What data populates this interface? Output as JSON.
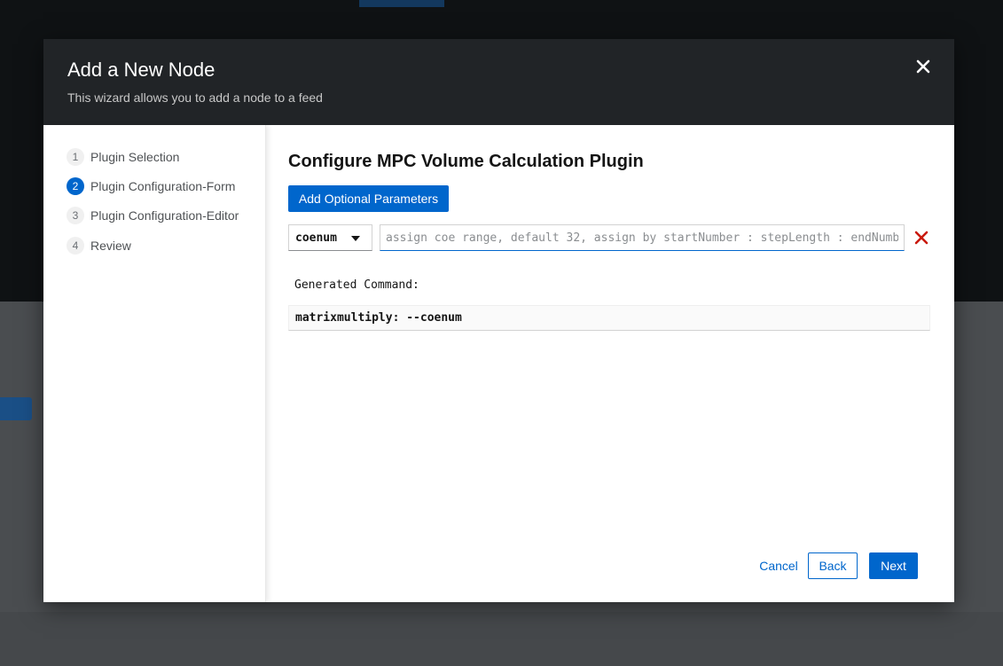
{
  "modal": {
    "title": "Add a New Node",
    "description": "This wizard allows you to add a node to a feed"
  },
  "wizard_nav": {
    "items": [
      {
        "number": "1",
        "label": "Plugin Selection"
      },
      {
        "number": "2",
        "label": "Plugin Configuration-Form"
      },
      {
        "number": "3",
        "label": "Plugin Configuration-Editor"
      },
      {
        "number": "4",
        "label": "Review"
      }
    ],
    "active_index": 1
  },
  "main": {
    "title": "Configure MPC Volume Calculation Plugin",
    "add_params_label": "Add Optional Parameters",
    "param_select_value": "coenum",
    "param_input_placeholder": "assign coe range, default 32, assign by startNumber : stepLength : endNumber",
    "generated_label": "Generated Command:",
    "generated_command": "matrixmultiply: --coenum"
  },
  "footer": {
    "cancel_label": "Cancel",
    "back_label": "Back",
    "next_label": "Next"
  },
  "colors": {
    "accent": "#0066cc",
    "header_bg": "#212427",
    "danger": "#c9190b"
  },
  "icons": {
    "close": "close-icon",
    "chevron": "chevron-down-icon",
    "remove": "remove-icon"
  }
}
